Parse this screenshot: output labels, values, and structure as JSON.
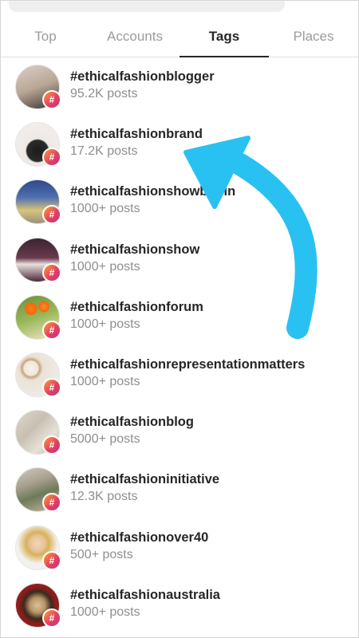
{
  "status_right": "",
  "tabs": [
    {
      "label": "Top",
      "active": false
    },
    {
      "label": "Accounts",
      "active": false
    },
    {
      "label": "Tags",
      "active": true
    },
    {
      "label": "Places",
      "active": false
    }
  ],
  "tags": [
    {
      "name": "#ethicalfashionblogger",
      "posts": "95.2K posts"
    },
    {
      "name": "#ethicalfashionbrand",
      "posts": "17.2K posts"
    },
    {
      "name": "#ethicalfashionshowberlin",
      "posts": "1000+ posts"
    },
    {
      "name": "#ethicalfashionshow",
      "posts": "1000+ posts"
    },
    {
      "name": "#ethicalfashionforum",
      "posts": "1000+ posts"
    },
    {
      "name": "#ethicalfashionrepresentationmatters",
      "posts": "1000+ posts"
    },
    {
      "name": "#ethicalfashionblog",
      "posts": "5000+ posts"
    },
    {
      "name": "#ethicalfashioninitiative",
      "posts": "12.3K posts"
    },
    {
      "name": "#ethicalfashionover40",
      "posts": "500+ posts"
    },
    {
      "name": "#ethicalfashionaustralia",
      "posts": "1000+ posts"
    }
  ],
  "badge_glyph": "#",
  "colors": {
    "arrow": "#29c1f2",
    "badge_start": "#f7a33b",
    "badge_end": "#c1357f",
    "active_tab": "#262626",
    "inactive_tab": "#9b9b9b"
  },
  "icons": {
    "badge": "hashtag-badge-icon",
    "annotation": "curved-arrow-annotation"
  }
}
